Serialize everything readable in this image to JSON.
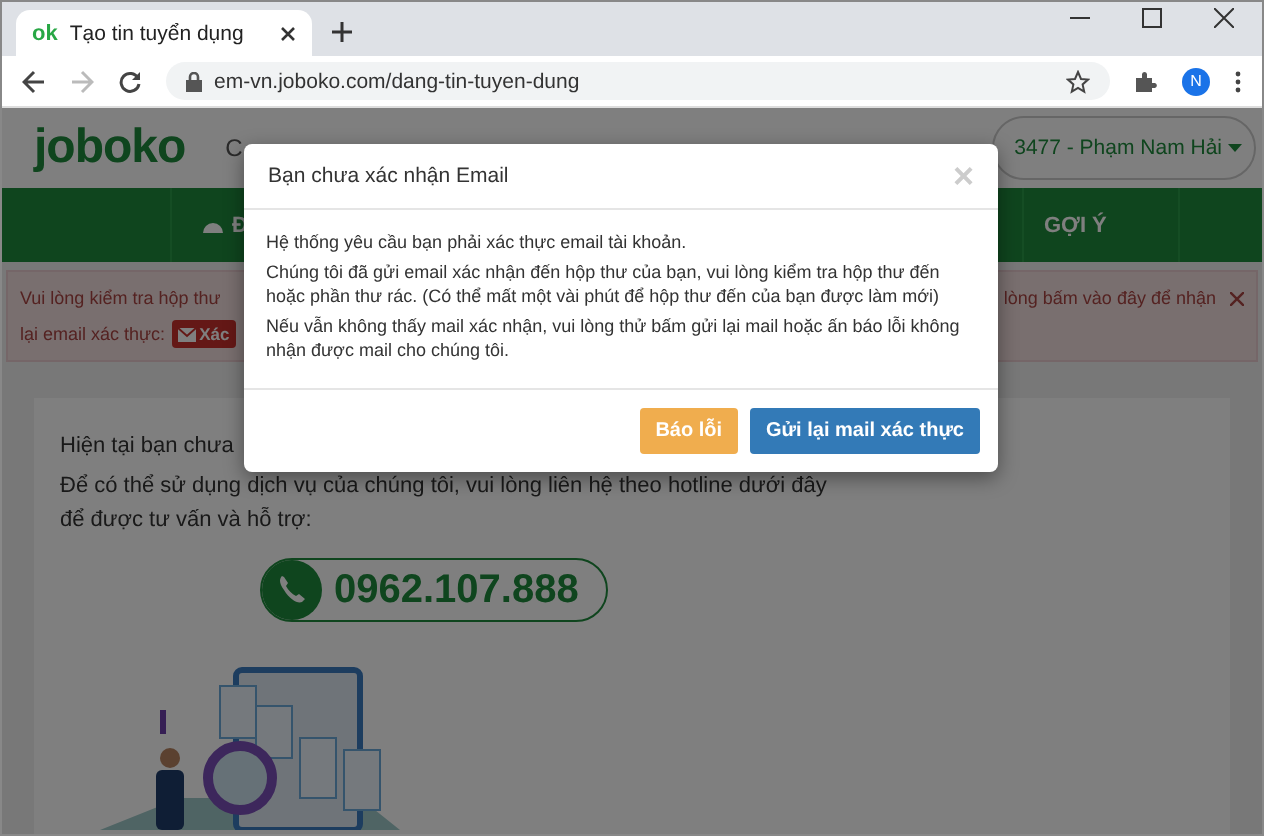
{
  "browser": {
    "tab_title": "Tạo tin tuyển dụng",
    "favicon": "ok",
    "url": "em-vn.joboko.com/dang-tin-tuyen-dung",
    "profile_initial": "N"
  },
  "header": {
    "logo": "joboko",
    "fragment": "C",
    "user": "3477 - Phạm Nam Hải"
  },
  "nav": [
    {
      "label": "Đ"
    },
    {
      "label": "GỢI Ý"
    }
  ],
  "alert": {
    "line1_left": "Vui lòng kiểm tra hộp thư",
    "line1_right": "lòng bấm vào đây để nhận",
    "line2": "lại email xác thực:",
    "button": "Xác"
  },
  "content": {
    "line1": "Hiện tại bạn chưa",
    "line2": "Để có thể sử dụng dịch vụ của chúng tôi, vui lòng liên hệ theo hotline dưới đây",
    "line3": "để được tư vấn và hỗ trợ:",
    "hotline": "0962.107.888"
  },
  "modal": {
    "title": "Bạn chưa xác nhận Email",
    "close": "×",
    "paragraphs": [
      "Hệ thống yêu cầu bạn phải xác thực email tài khoản.",
      "Chúng tôi đã gửi email xác nhận đến hộp thư của bạn, vui lòng kiểm tra hộp thư đến hoặc phần thư rác. (Có thể mất một vài phút để hộp thư đến của bạn được làm mới)",
      "Nếu vẫn không thấy mail xác nhận, vui lòng thử bấm gửi lại mail hoặc ấn báo lỗi không nhận được mail cho chúng tôi."
    ],
    "buttons": [
      {
        "label": "Báo lỗi",
        "kind": "warning"
      },
      {
        "label": "Gửi lại mail xác thực",
        "kind": "primary"
      }
    ]
  }
}
